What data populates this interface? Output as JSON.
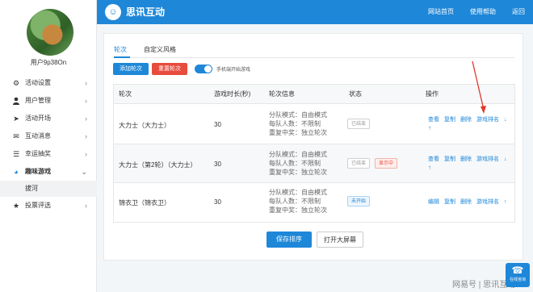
{
  "sidebar": {
    "username": "用户9p38On",
    "menu": [
      {
        "label": "活动设置",
        "icon": "gear-icon",
        "glyph": "⚙",
        "expanded": false
      },
      {
        "label": "用户管理",
        "icon": "user-icon",
        "glyph": "👤",
        "expanded": false
      },
      {
        "label": "活动开场",
        "icon": "send-icon",
        "glyph": "➤",
        "expanded": false
      },
      {
        "label": "互动消息",
        "icon": "message-icon",
        "glyph": "✉",
        "expanded": false
      },
      {
        "label": "幸运抽奖",
        "icon": "list-icon",
        "glyph": "☰",
        "expanded": false
      },
      {
        "label": "趣味游戏",
        "icon": "game-icon",
        "glyph": "◕",
        "expanded": true
      },
      {
        "label": "投票评选",
        "icon": "star-icon",
        "glyph": "★",
        "expanded": false
      }
    ],
    "submenu": [
      "拔河"
    ]
  },
  "header": {
    "brand": "思讯互动",
    "nav": [
      "网站首页",
      "使用帮助",
      "返回"
    ]
  },
  "tabs": [
    "轮次",
    "自定义风格"
  ],
  "toolbar": {
    "add_label": "添加轮次",
    "reset_label": "重置轮次",
    "toggle_label": "手机端开始游戏"
  },
  "table": {
    "headers": [
      "轮次",
      "游戏时长(秒)",
      "轮次信息",
      "状态",
      "操作"
    ],
    "rows": [
      {
        "name": "大力士（大力士）",
        "duration": "30",
        "info": [
          "分队模式：自由模式",
          "每队人数：不限制",
          "重复中奖：独立轮次"
        ],
        "statuses": [
          {
            "label": "已结束",
            "type": "ended"
          }
        ],
        "ops": [
          "查看",
          "复制",
          "删除",
          "游戏排名"
        ],
        "arrows": [
          "↓",
          "↑"
        ]
      },
      {
        "name": "大力士（第2轮）（大力士）",
        "duration": "30",
        "info": [
          "分队模式：自由模式",
          "每队人数：不限制",
          "重复中奖：独立轮次"
        ],
        "statuses": [
          {
            "label": "已结束",
            "type": "ended"
          },
          {
            "label": "显示中",
            "type": "show"
          }
        ],
        "ops": [
          "查看",
          "复制",
          "删除",
          "游戏排名"
        ],
        "arrows": [
          "↓",
          "↑"
        ]
      },
      {
        "name": "锦衣卫（锦衣卫）",
        "duration": "30",
        "info": [
          "分队模式：自由模式",
          "每队人数：不限制",
          "重复中奖：独立轮次"
        ],
        "statuses": [
          {
            "label": "未开始",
            "type": "pending"
          }
        ],
        "ops": [
          "编辑",
          "复制",
          "删除",
          "游戏排名"
        ],
        "arrows": [
          "↑"
        ]
      }
    ]
  },
  "bottom": {
    "save_label": "保存排序",
    "screen_label": "打开大屏幕"
  },
  "floating": {
    "label": "在线咨询"
  },
  "watermark": "网易号 | 思讯互动",
  "colors": {
    "primary": "#1e87d8",
    "danger": "#e84c3d",
    "annotation": "#e0392b"
  }
}
